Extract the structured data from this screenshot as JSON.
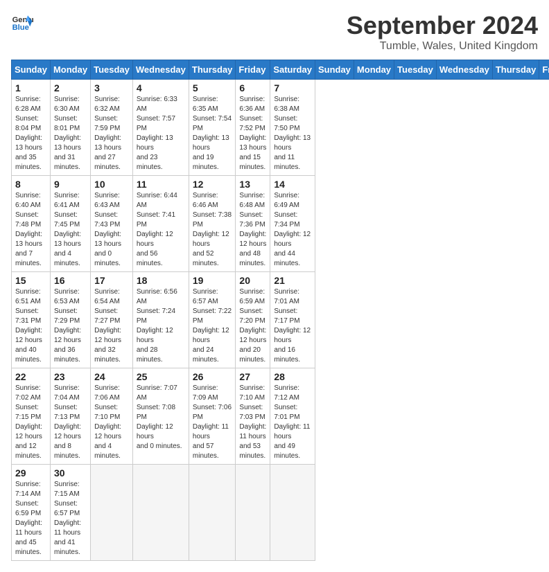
{
  "header": {
    "logo_line1": "General",
    "logo_line2": "Blue",
    "title": "September 2024",
    "location": "Tumble, Wales, United Kingdom"
  },
  "days_of_week": [
    "Sunday",
    "Monday",
    "Tuesday",
    "Wednesday",
    "Thursday",
    "Friday",
    "Saturday"
  ],
  "weeks": [
    [
      {
        "day": "1",
        "info": "Sunrise: 6:28 AM\nSunset: 8:04 PM\nDaylight: 13 hours\nand 35 minutes."
      },
      {
        "day": "2",
        "info": "Sunrise: 6:30 AM\nSunset: 8:01 PM\nDaylight: 13 hours\nand 31 minutes."
      },
      {
        "day": "3",
        "info": "Sunrise: 6:32 AM\nSunset: 7:59 PM\nDaylight: 13 hours\nand 27 minutes."
      },
      {
        "day": "4",
        "info": "Sunrise: 6:33 AM\nSunset: 7:57 PM\nDaylight: 13 hours\nand 23 minutes."
      },
      {
        "day": "5",
        "info": "Sunrise: 6:35 AM\nSunset: 7:54 PM\nDaylight: 13 hours\nand 19 minutes."
      },
      {
        "day": "6",
        "info": "Sunrise: 6:36 AM\nSunset: 7:52 PM\nDaylight: 13 hours\nand 15 minutes."
      },
      {
        "day": "7",
        "info": "Sunrise: 6:38 AM\nSunset: 7:50 PM\nDaylight: 13 hours\nand 11 minutes."
      }
    ],
    [
      {
        "day": "8",
        "info": "Sunrise: 6:40 AM\nSunset: 7:48 PM\nDaylight: 13 hours\nand 7 minutes."
      },
      {
        "day": "9",
        "info": "Sunrise: 6:41 AM\nSunset: 7:45 PM\nDaylight: 13 hours\nand 4 minutes."
      },
      {
        "day": "10",
        "info": "Sunrise: 6:43 AM\nSunset: 7:43 PM\nDaylight: 13 hours\nand 0 minutes."
      },
      {
        "day": "11",
        "info": "Sunrise: 6:44 AM\nSunset: 7:41 PM\nDaylight: 12 hours\nand 56 minutes."
      },
      {
        "day": "12",
        "info": "Sunrise: 6:46 AM\nSunset: 7:38 PM\nDaylight: 12 hours\nand 52 minutes."
      },
      {
        "day": "13",
        "info": "Sunrise: 6:48 AM\nSunset: 7:36 PM\nDaylight: 12 hours\nand 48 minutes."
      },
      {
        "day": "14",
        "info": "Sunrise: 6:49 AM\nSunset: 7:34 PM\nDaylight: 12 hours\nand 44 minutes."
      }
    ],
    [
      {
        "day": "15",
        "info": "Sunrise: 6:51 AM\nSunset: 7:31 PM\nDaylight: 12 hours\nand 40 minutes."
      },
      {
        "day": "16",
        "info": "Sunrise: 6:53 AM\nSunset: 7:29 PM\nDaylight: 12 hours\nand 36 minutes."
      },
      {
        "day": "17",
        "info": "Sunrise: 6:54 AM\nSunset: 7:27 PM\nDaylight: 12 hours\nand 32 minutes."
      },
      {
        "day": "18",
        "info": "Sunrise: 6:56 AM\nSunset: 7:24 PM\nDaylight: 12 hours\nand 28 minutes."
      },
      {
        "day": "19",
        "info": "Sunrise: 6:57 AM\nSunset: 7:22 PM\nDaylight: 12 hours\nand 24 minutes."
      },
      {
        "day": "20",
        "info": "Sunrise: 6:59 AM\nSunset: 7:20 PM\nDaylight: 12 hours\nand 20 minutes."
      },
      {
        "day": "21",
        "info": "Sunrise: 7:01 AM\nSunset: 7:17 PM\nDaylight: 12 hours\nand 16 minutes."
      }
    ],
    [
      {
        "day": "22",
        "info": "Sunrise: 7:02 AM\nSunset: 7:15 PM\nDaylight: 12 hours\nand 12 minutes."
      },
      {
        "day": "23",
        "info": "Sunrise: 7:04 AM\nSunset: 7:13 PM\nDaylight: 12 hours\nand 8 minutes."
      },
      {
        "day": "24",
        "info": "Sunrise: 7:06 AM\nSunset: 7:10 PM\nDaylight: 12 hours\nand 4 minutes."
      },
      {
        "day": "25",
        "info": "Sunrise: 7:07 AM\nSunset: 7:08 PM\nDaylight: 12 hours\nand 0 minutes."
      },
      {
        "day": "26",
        "info": "Sunrise: 7:09 AM\nSunset: 7:06 PM\nDaylight: 11 hours\nand 57 minutes."
      },
      {
        "day": "27",
        "info": "Sunrise: 7:10 AM\nSunset: 7:03 PM\nDaylight: 11 hours\nand 53 minutes."
      },
      {
        "day": "28",
        "info": "Sunrise: 7:12 AM\nSunset: 7:01 PM\nDaylight: 11 hours\nand 49 minutes."
      }
    ],
    [
      {
        "day": "29",
        "info": "Sunrise: 7:14 AM\nSunset: 6:59 PM\nDaylight: 11 hours\nand 45 minutes."
      },
      {
        "day": "30",
        "info": "Sunrise: 7:15 AM\nSunset: 6:57 PM\nDaylight: 11 hours\nand 41 minutes."
      },
      {
        "day": "",
        "info": ""
      },
      {
        "day": "",
        "info": ""
      },
      {
        "day": "",
        "info": ""
      },
      {
        "day": "",
        "info": ""
      },
      {
        "day": "",
        "info": ""
      }
    ]
  ]
}
